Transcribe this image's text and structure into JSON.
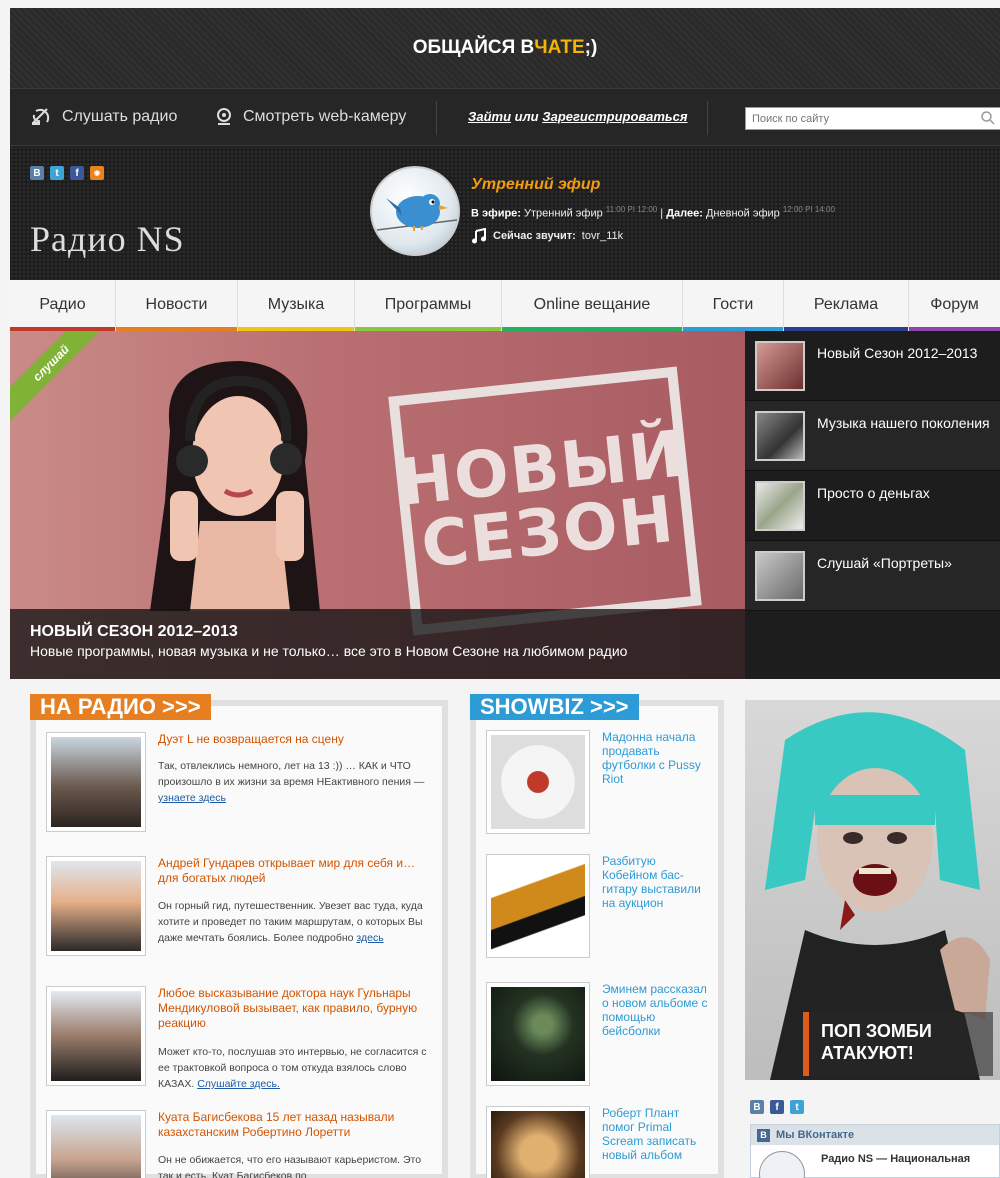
{
  "top_banner": {
    "text_before": "ОБЩАЙСЯ В ",
    "highlight": "ЧАТЕ",
    "text_after": " ;)"
  },
  "utility_bar": {
    "listen_radio": "Слушать радио",
    "watch_webcam": "Смотреть web-камеру",
    "login": "Зайти",
    "or": " или ",
    "register": "Зарегистрироваться",
    "search_placeholder": "Поиск по сайту"
  },
  "header": {
    "social": [
      "В",
      "t",
      "f",
      "rss"
    ],
    "logo": "Радио NS",
    "show_title": "Утренний эфир",
    "on_air_label": "В эфире:",
    "on_air_value": "Утренний эфир",
    "on_air_time": "11:00 PI 12:00",
    "divider": " | ",
    "next_label": "Далее:",
    "next_value": "Дневной эфир",
    "next_time": "12:00 PI 14:00",
    "now_playing_label": "Сейчас звучит:",
    "now_playing_value": "tovr_11k"
  },
  "nav": [
    {
      "label": "Радио",
      "color": "#c0392b"
    },
    {
      "label": "Новости",
      "color": "#e67e22"
    },
    {
      "label": "Музыка",
      "color": "#f1c40f"
    },
    {
      "label": "Программы",
      "color": "#8cc63f"
    },
    {
      "label": "Online вещание",
      "color": "#27ae60"
    },
    {
      "label": "Гости",
      "color": "#2d9bd6"
    },
    {
      "label": "Реклама",
      "color": "#2c3e90"
    },
    {
      "label": "Форум",
      "color": "#8e44ad"
    }
  ],
  "hero": {
    "ribbon": "слушай",
    "stamp_line1": "НОВЫЙ",
    "stamp_line2": "СЕЗОН",
    "caption_title": "НОВЫЙ СЕЗОН 2012–2013",
    "caption_text": "Новые программы, новая музыка и не только… все это в Новом Сезоне на любимом радио"
  },
  "hero_side": [
    {
      "label": "Новый Сезон 2012–2013"
    },
    {
      "label": "Музыка нашего поколения"
    },
    {
      "label": "Просто о деньгах"
    },
    {
      "label": "Слушай «Портреты»"
    }
  ],
  "na_radio": {
    "heading": "НА РАДИО >>>",
    "items": [
      {
        "title": "Дуэт L не возвращается на сцену",
        "text": "Так, отвлеклись немного, лет на 13 :)) … КАК и ЧТО произошло в их жизни за время НЕактивного пения — ",
        "link": "узнаете здесь"
      },
      {
        "title": "Андрей Гундарев открывает мир для себя и… для богатых людей",
        "text": "Он горный гид, путешественник. Увезет вас туда, куда хотите и проведет по таким маршрутам, о которых Вы даже мечтать боялись. Более подробно ",
        "link": "здесь"
      },
      {
        "title": "Любое высказывание доктора наук Гульнары Мендикуловой вызывает, как правило, бурную реакцию",
        "text": "Может кто-то, послушав это интервью, не согласится с ее трактовкой вопроса о том откуда взялось слово КАЗАХ. ",
        "link": "Слушайте здесь."
      },
      {
        "title": "Куата Багисбекова 15 лет назад называли казахстанским Робертино Лоретти",
        "text": "Он не обижается, что его называют карьеристом. Это так и есть. Куат Багисбеков по",
        "link": ""
      }
    ]
  },
  "showbiz": {
    "heading": "SHOWBIZ >>>",
    "items": [
      {
        "title": "Мадонна начала продавать футболки с Pussy Riot"
      },
      {
        "title": "Разбитую Кобейном бас-гитару выставили на аукцион"
      },
      {
        "title": "Эминем рассказал о новом альбоме с помощью бейсболки"
      },
      {
        "title": "Роберт Плант помог Primal Scream записать новый альбом"
      }
    ]
  },
  "promo": {
    "line1": "ПОП ЗОМБИ",
    "line2": "АТАКУЮТ!"
  },
  "vk": {
    "icons": [
      "В",
      "f",
      "t"
    ],
    "widget_title": "Мы ВКонтакте",
    "group_name": "Радио NS — Национальная"
  },
  "colors": {
    "accent_orange": "#f39c12",
    "radio_orange": "#e67e22",
    "showbiz_blue": "#2d9bd6",
    "vk_blue": "#45688e"
  }
}
